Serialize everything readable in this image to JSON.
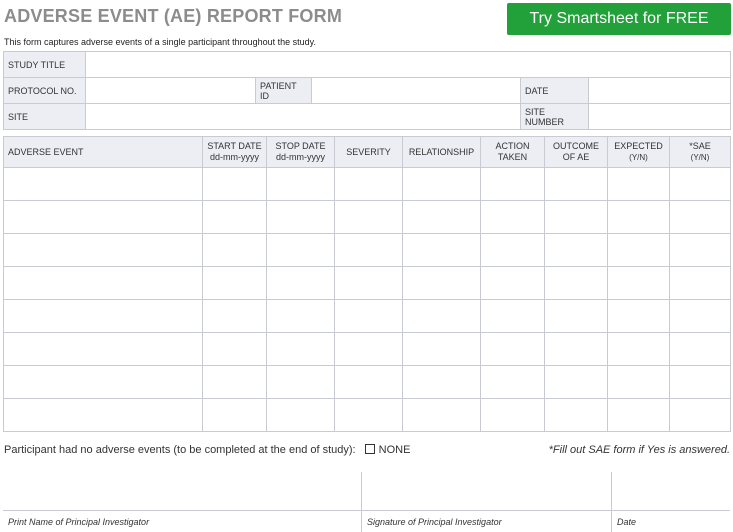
{
  "header": {
    "title": "ADVERSE EVENT (AE) REPORT FORM",
    "cta_label": "Try Smartsheet for FREE",
    "subtitle": "This form captures adverse events of a single participant throughout the study."
  },
  "info": {
    "study_title": "STUDY TITLE",
    "protocol_no": "PROTOCOL NO.",
    "patient_id": "PATIENT ID",
    "date": "DATE",
    "site": "SITE",
    "site_number": "SITE NUMBER"
  },
  "ae_table": {
    "col_adverse_event": "ADVERSE EVENT",
    "col_start_date": "START DATE",
    "col_start_date_fmt": "dd-mm-yyyy",
    "col_stop_date": "STOP DATE",
    "col_stop_date_fmt": "dd-mm-yyyy",
    "col_severity": "SEVERITY",
    "col_relationship": "RELATIONSHIP",
    "col_action_taken_1": "ACTION",
    "col_action_taken_2": "TAKEN",
    "col_outcome_1": "OUTCOME",
    "col_outcome_2": "OF AE",
    "col_expected_1": "EXPECTED",
    "col_expected_2": "(Y/N)",
    "col_sae_1": "*SAE",
    "col_sae_2": "(Y/N)"
  },
  "footer": {
    "no_events_text": "Participant had no adverse events (to be completed at the end of study):",
    "none_label": "NONE",
    "sae_note": "*Fill out SAE form if Yes is answered.",
    "print_name_label": "Print Name of Principal Investigator",
    "signature_label": "Signature of Principal Investigator",
    "date_label": "Date"
  }
}
